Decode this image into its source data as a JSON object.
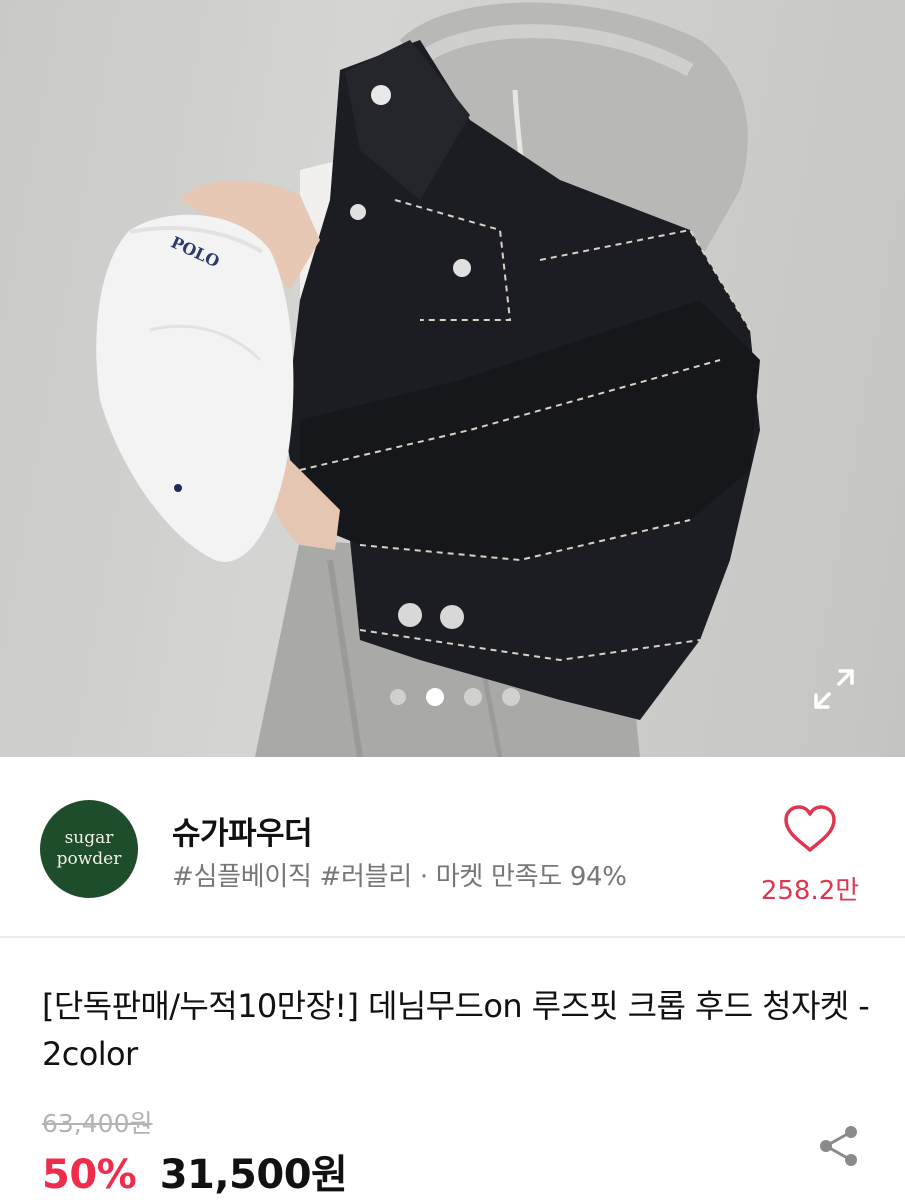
{
  "product_image": {
    "cap_text": "POLO",
    "carousel": {
      "total": 4,
      "active_index": 1
    },
    "expand_icon": "expand-icon"
  },
  "seller": {
    "logo_line1": "sugar",
    "logo_line2": "powder",
    "name": "슈가파우더",
    "tags": "#심플베이직 #러블리 · 마켓 만족도 94%",
    "like_icon": "heart-outline-icon",
    "like_count": "258.2만",
    "accent_color": "#e0364f",
    "logo_color": "#1e4d2b"
  },
  "product": {
    "title": "[단독판매/누적10만장!] 데님무드on 루즈핏 크롭 후드 청자켓 - 2color",
    "original_price": "63,400원",
    "discount": "50%",
    "price": "31,500원",
    "discount_color": "#f02c4d",
    "share_icon": "share-icon"
  }
}
